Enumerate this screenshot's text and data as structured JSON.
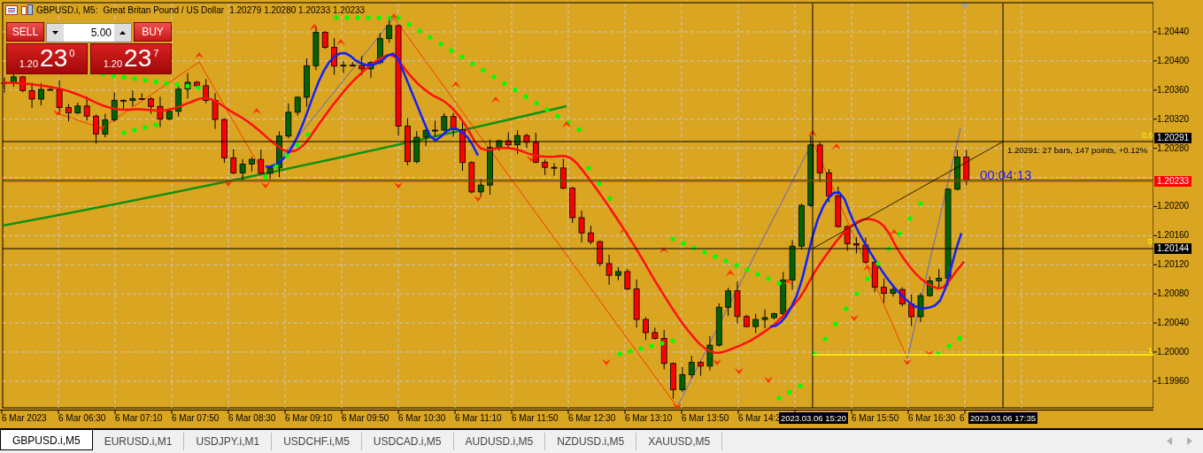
{
  "title": {
    "symbol": "GBPUSD.i, M5:",
    "description": "Great Britan Pound / US Dollar",
    "ohlc": "1.20279 1.20280 1.20233 1.20233"
  },
  "trade_panel": {
    "sell": {
      "label": "SELL",
      "prefix": "1.20",
      "big": "23",
      "sup": "0"
    },
    "volume": "5.00",
    "buy": {
      "label": "BUY",
      "prefix": "1.20",
      "big": "23",
      "sup": "7"
    }
  },
  "measure_label": "1.20291: 27 bars, 147 points, +0.12%",
  "timer": "00:04:13",
  "fib_levels": [
    "0.0",
    "0",
    "1"
  ],
  "price_axis": {
    "labels": [
      "1.20440",
      "1.20400",
      "1.20360",
      "1.20320",
      "1.20280",
      "1.20200",
      "1.20160",
      "1.20120",
      "1.20080",
      "1.20040",
      "1.20000",
      "1.19960"
    ],
    "markers": [
      {
        "value": "1.20291",
        "kind": "line"
      },
      {
        "value": "1.20233",
        "kind": "bid"
      },
      {
        "value": "1.20144",
        "kind": "line"
      }
    ]
  },
  "time_axis": {
    "labels": [
      "6 Mar 2023",
      "6 Mar 06:30",
      "6 Mar 07:10",
      "6 Mar 07:50",
      "6 Mar 08:30",
      "6 Mar 09:10",
      "6 Mar 09:50",
      "6 Mar 10:30",
      "6 Mar 11:10",
      "6 Mar 11:50",
      "6 Mar 12:30",
      "6 Mar 13:10",
      "6 Mar 13:50",
      "6 Mar 14:3",
      "2023.03.06 15:20",
      "6 Mar 15:50",
      "6 Mar 16:30",
      "6"
    ],
    "markers": [
      "2023.03.06 17:35"
    ]
  },
  "tabs": [
    {
      "label": "GBPUSD.i,M5",
      "selected": true
    },
    {
      "label": "EURUSD.i,M1",
      "selected": false
    },
    {
      "label": "USDJPY.i,M1",
      "selected": false
    },
    {
      "label": "USDCHF.i,M5",
      "selected": false
    },
    {
      "label": "USDCAD.i,M5",
      "selected": false
    },
    {
      "label": "AUDUSD.i,M5",
      "selected": false
    },
    {
      "label": "NZDUSD.i,M5",
      "selected": false
    },
    {
      "label": "XAUUSD,M5",
      "selected": false
    }
  ]
}
